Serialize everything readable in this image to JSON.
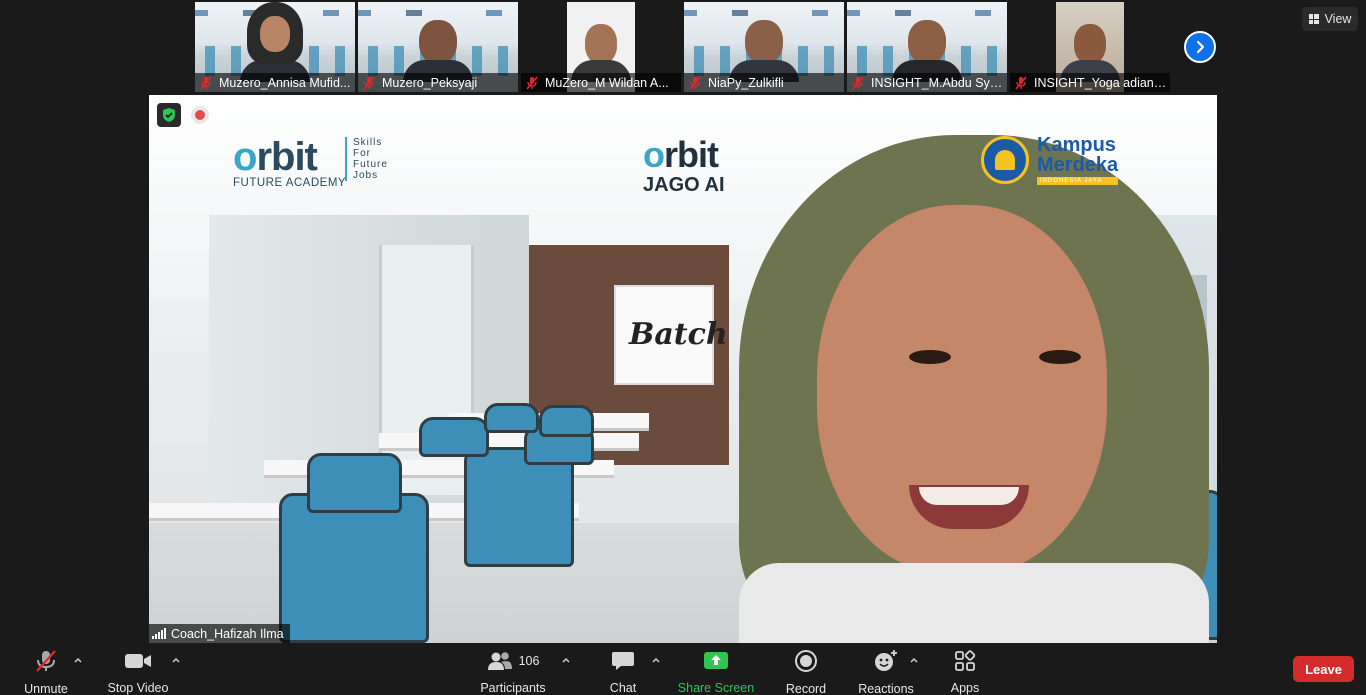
{
  "participants_strip": {
    "tiles": [
      {
        "name": "Muzero_Annisa Mufid..."
      },
      {
        "name": "Muzero_Peksyaji"
      },
      {
        "name": "MuZero_M Wildan A..."
      },
      {
        "name": "NiaPy_Zulkifli"
      },
      {
        "name": "INSIGHT_M.Abdu Sya..."
      },
      {
        "name": "INSIGHT_Yoga adians..."
      }
    ],
    "view_label": "View"
  },
  "main_video": {
    "speaker_name": "Coach_Hafizah Ilma",
    "background": {
      "logo_left_word": "rbit",
      "logo_left_sub": "FUTURE ACADEMY",
      "logo_left_tag": [
        "Skills",
        "For",
        "Future",
        "Jobs"
      ],
      "logo_center_word": "rbit",
      "logo_center_sub": "JAGO AI",
      "logo_right_line1": "Kampus",
      "logo_right_line2": "Merdeka",
      "logo_right_line3": "INDONESIA JAYA",
      "board_text": "Batch"
    }
  },
  "toolbar": {
    "unmute": "Unmute",
    "stop_video": "Stop Video",
    "participants": "Participants",
    "participants_count": "106",
    "chat": "Chat",
    "share_screen": "Share Screen",
    "record": "Record",
    "reactions": "Reactions",
    "apps": "Apps",
    "leave": "Leave"
  },
  "colors": {
    "accent_blue": "#0e71eb",
    "share_green": "#30c453",
    "leave_red": "#d42b2b",
    "mic_off_red": "#e02828"
  }
}
